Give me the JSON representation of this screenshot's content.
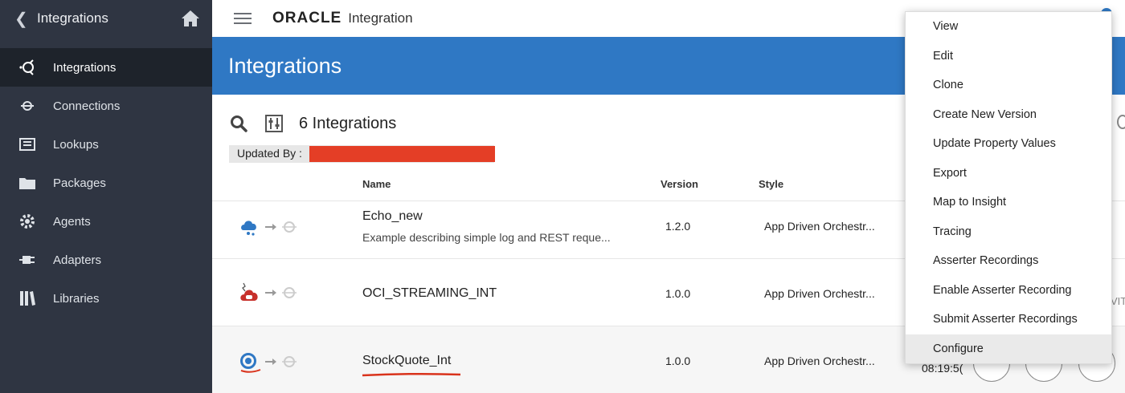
{
  "sidebar": {
    "title": "Integrations",
    "items": [
      {
        "label": "Integrations",
        "icon": "integration-icon",
        "active": true
      },
      {
        "label": "Connections",
        "icon": "connection-icon"
      },
      {
        "label": "Lookups",
        "icon": "lookup-icon"
      },
      {
        "label": "Packages",
        "icon": "package-icon"
      },
      {
        "label": "Agents",
        "icon": "gear-icon"
      },
      {
        "label": "Adapters",
        "icon": "plug-icon"
      },
      {
        "label": "Libraries",
        "icon": "library-icon"
      }
    ]
  },
  "topbar": {
    "brand": "ORACLE",
    "product": "Integration"
  },
  "banner": {
    "title": "Integrations"
  },
  "toolbar": {
    "count_label": "6 Integrations",
    "filter_chip_label": "Updated By :"
  },
  "table": {
    "columns": [
      "Name",
      "Version",
      "Style"
    ],
    "rows": [
      {
        "name": "Echo_new",
        "description": "Example describing simple log and REST reque...",
        "version": "1.2.0",
        "style": "App Driven Orchestr..."
      },
      {
        "name": "OCI_STREAMING_INT",
        "description": "",
        "version": "1.0.0",
        "style": "App Driven Orchestr..."
      },
      {
        "name": "StockQuote_Int",
        "description": "",
        "version": "1.0.0",
        "style": "App Driven Orchestr...",
        "time": "08:19:5("
      }
    ]
  },
  "edge_text": "VIT",
  "context_menu": {
    "items": [
      "View",
      "Edit",
      "Clone",
      "Create New Version",
      "Update Property Values",
      "Export",
      "Map to Insight",
      "Tracing",
      "Asserter Recordings",
      "Enable Asserter Recording",
      "Submit Asserter Recordings",
      "Configure"
    ],
    "highlighted": "Configure"
  },
  "colors": {
    "sidebar_bg": "#2f3542",
    "banner_bg": "#2f78c4",
    "redaction": "#e43e26",
    "annotation_underline": "#d9331c"
  }
}
